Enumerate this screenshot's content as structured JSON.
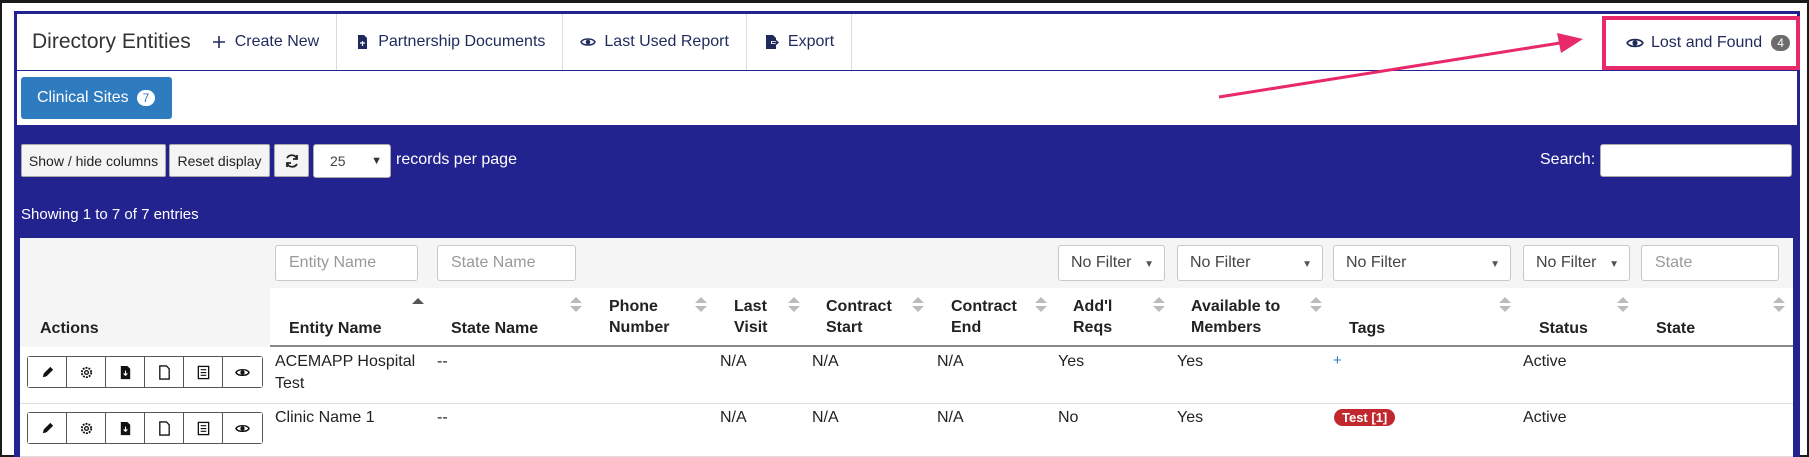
{
  "nav": {
    "title": "Directory Entities",
    "items": [
      {
        "label": "Create New",
        "icon": "plus-icon"
      },
      {
        "label": "Partnership Documents",
        "icon": "document-icon"
      },
      {
        "label": "Last Used Report",
        "icon": "eye-icon"
      },
      {
        "label": "Export",
        "icon": "export-icon"
      }
    ],
    "lost_found": {
      "label": "Lost and Found",
      "count": "4",
      "icon": "eye-icon"
    }
  },
  "tabs": [
    {
      "label": "Clinical Sites",
      "count": "7"
    }
  ],
  "toolbar": {
    "show_hide": "Show / hide columns",
    "reset": "Reset display",
    "refresh_icon": "refresh-icon",
    "page_size": "25",
    "records_per_page": "records per page",
    "search_label": "Search:",
    "search_value": "",
    "showing": "Showing 1 to 7 of 7 entries"
  },
  "filters": {
    "entity_name": "Entity Name",
    "state_name": "State Name",
    "add_reqs": "No Filter",
    "available": "No Filter",
    "tags": "No Filter",
    "status": "No Filter",
    "state": "State"
  },
  "columns": {
    "actions": "Actions",
    "entity_name": "Entity Name",
    "state_name": "State Name",
    "phone_1": "Phone",
    "phone_2": "Number",
    "last_visit_1": "Last",
    "last_visit_2": "Visit",
    "contract_start_1": "Contract",
    "contract_start_2": "Start",
    "contract_end_1": "Contract",
    "contract_end_2": "End",
    "addl_reqs_1": "Add'l",
    "addl_reqs_2": "Reqs",
    "available_1": "Available to",
    "available_2": "Members",
    "tags": "Tags",
    "status": "Status",
    "state": "State"
  },
  "rows": [
    {
      "entity_name_1": "ACEMAPP Hospital",
      "entity_name_2": "Test",
      "state_name": "--",
      "phone": "",
      "last_visit": "N/A",
      "contract_start": "N/A",
      "contract_end": "N/A",
      "addl_reqs": "Yes",
      "available": "Yes",
      "tags": "+",
      "status": "Active",
      "state": ""
    },
    {
      "entity_name_1": "Clinic Name 1",
      "entity_name_2": "",
      "state_name": "--",
      "phone": "",
      "last_visit": "N/A",
      "contract_start": "N/A",
      "contract_end": "N/A",
      "addl_reqs": "No",
      "available": "Yes",
      "tags": "Test [1]",
      "status": "Active",
      "state": ""
    }
  ],
  "action_icons": [
    "pencil-icon",
    "gear-icon",
    "file-download-icon",
    "file-icon",
    "list-icon",
    "eye-icon"
  ],
  "colors": {
    "panel": "#23238f",
    "accent": "#2e7bbf",
    "highlight": "#e8296a",
    "tag": "#c0282d"
  }
}
